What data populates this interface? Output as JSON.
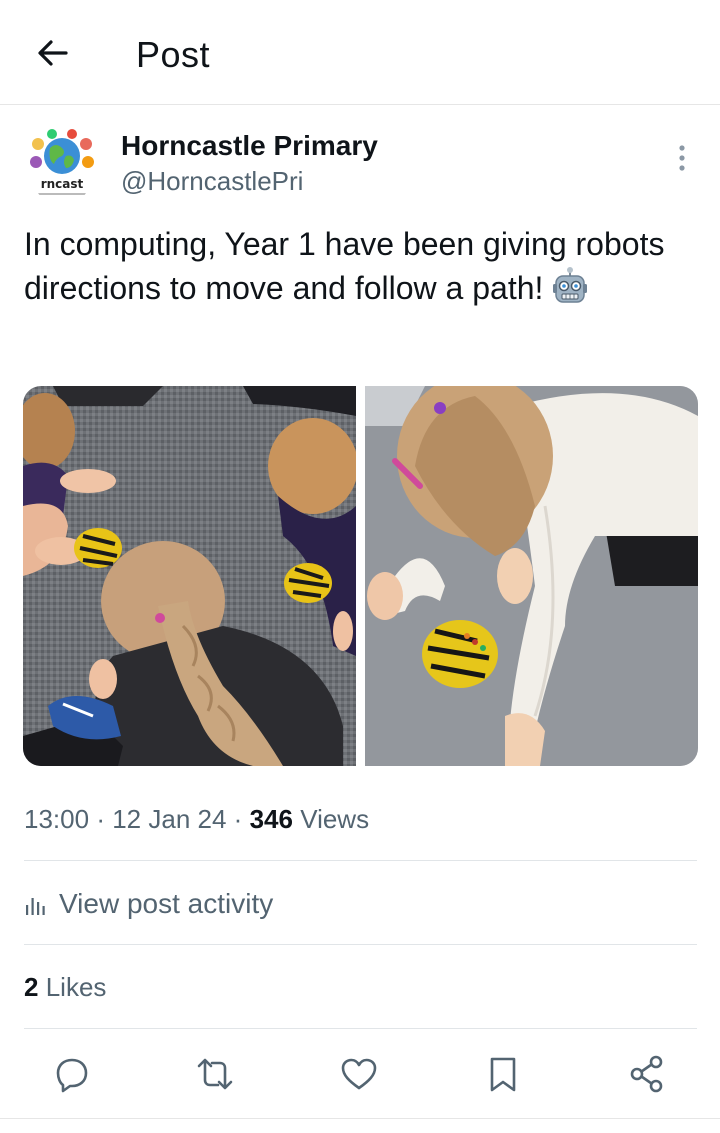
{
  "header": {
    "title": "Post",
    "back_icon": "arrow-left-icon"
  },
  "author": {
    "name": "Horncastle Primary",
    "handle": "@HorncastlePri",
    "avatar_text": "rncast"
  },
  "post": {
    "text": "In computing, Year 1 have been giving robots directions to move and follow a path!",
    "emoji": "robot-face-icon"
  },
  "meta": {
    "time": "13:00",
    "separator": "·",
    "date": "12 Jan 24",
    "views_count": "346",
    "views_label": "Views"
  },
  "activity": {
    "label": "View post activity"
  },
  "likes": {
    "count": "2",
    "label": "Likes"
  },
  "actions": [
    "reply-icon",
    "repost-icon",
    "like-icon",
    "bookmark-icon",
    "share-icon"
  ],
  "colors": {
    "text": "#0f1419",
    "secondary": "#536471",
    "divider": "#e1e5e8"
  }
}
